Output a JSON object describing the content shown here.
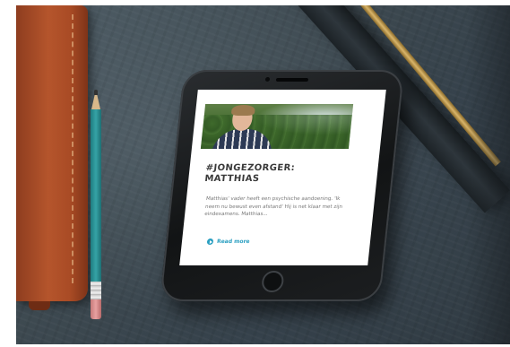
{
  "article": {
    "title": "#JONGEZORGER: MATTHIAS",
    "excerpt": "Matthias' vader heeft een psychische aandoening. 'Ik neem nu bewust even afstand' Hij is net klaar met zijn eindexamens. Matthias...",
    "read_more_label": "Read more"
  },
  "colors": {
    "accent": "#2a9fc1",
    "title": "#3a3a3a",
    "excerpt": "#777777"
  },
  "icons": {
    "read_more": "play-circle-icon"
  }
}
